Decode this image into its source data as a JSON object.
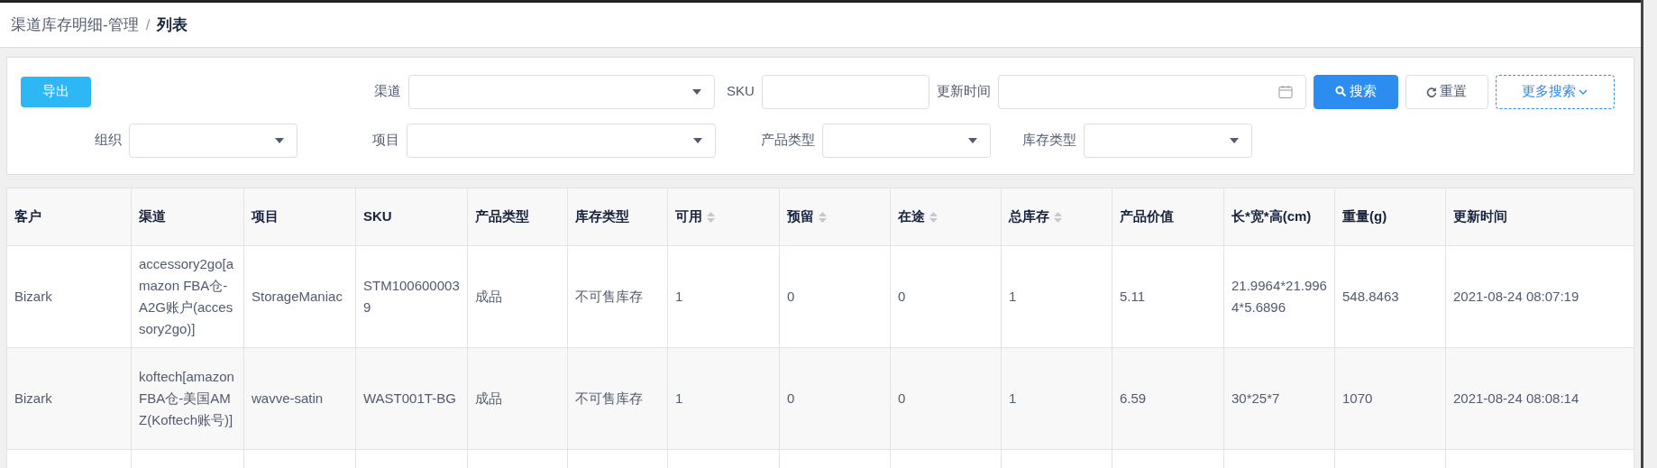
{
  "breadcrumb": [
    {
      "label": "渠道库存明细-管理",
      "current": false
    },
    {
      "label": "列表",
      "current": true
    }
  ],
  "breadcrumb_separator": "/",
  "export_button": "导出",
  "filters_row1": [
    {
      "kind": "select",
      "label": "渠道"
    },
    {
      "kind": "input",
      "label": "SKU"
    },
    {
      "kind": "date",
      "label": "更新时间"
    }
  ],
  "buttons": [
    {
      "kind": "primary",
      "label": "搜索"
    },
    {
      "kind": "reset",
      "label": "重置"
    },
    {
      "kind": "more",
      "label": "更多搜索"
    }
  ],
  "filters_row2": [
    {
      "kind": "select",
      "label": "组织"
    },
    {
      "kind": "select",
      "label": "项目"
    },
    {
      "kind": "select",
      "label": "产品类型"
    },
    {
      "kind": "select",
      "label": "库存类型"
    }
  ],
  "table": {
    "columns": [
      {
        "label": "客户",
        "sortable": false
      },
      {
        "label": "渠道",
        "sortable": false
      },
      {
        "label": "项目",
        "sortable": false
      },
      {
        "label": "SKU",
        "sortable": false
      },
      {
        "label": "产品类型",
        "sortable": false
      },
      {
        "label": "库存类型",
        "sortable": false
      },
      {
        "label": "可用",
        "sortable": true
      },
      {
        "label": "预留",
        "sortable": true
      },
      {
        "label": "在途",
        "sortable": true
      },
      {
        "label": "总库存",
        "sortable": true
      },
      {
        "label": "产品价值",
        "sortable": false
      },
      {
        "label": "长*宽*高(cm)",
        "sortable": false
      },
      {
        "label": "重量(g)",
        "sortable": false
      },
      {
        "label": "更新时间",
        "sortable": false
      }
    ],
    "rows": [
      [
        "Bizark",
        "accessory2go[amazon FBA仓-A2G账户(accessory2go)]",
        "StorageManiac",
        "STM1006000039",
        "成品",
        "不可售库存",
        "1",
        "0",
        "0",
        "1",
        "5.11",
        "21.9964*21.9964*5.6896",
        "548.8463",
        "2021-08-24 08:07:19"
      ],
      [
        "Bizark",
        "koftech[amazon FBA仓-美国AMZ(Koftech账号)]",
        "wavve-satin",
        "WAST001T-BG",
        "成品",
        "不可售库存",
        "1",
        "0",
        "0",
        "1",
        "6.59",
        "30*25*7",
        "1070",
        "2021-08-24 08:08:14"
      ]
    ]
  }
}
